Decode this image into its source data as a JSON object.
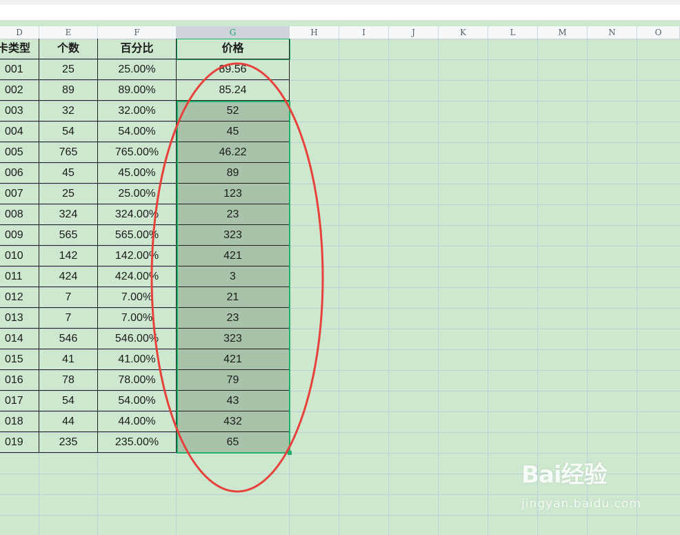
{
  "columns": [
    "D",
    "E",
    "F",
    "G",
    "H",
    "I",
    "J",
    "K",
    "L",
    "M",
    "N",
    "O"
  ],
  "selected_column": "G",
  "table": {
    "headers": [
      "卡类型",
      "个数",
      "百分比",
      "价格"
    ],
    "rows": [
      [
        "001",
        "25",
        "25.00%",
        "89.56"
      ],
      [
        "002",
        "89",
        "89.00%",
        "85.24"
      ],
      [
        "003",
        "32",
        "32.00%",
        "52"
      ],
      [
        "004",
        "54",
        "54.00%",
        "45"
      ],
      [
        "005",
        "765",
        "765.00%",
        "46.22"
      ],
      [
        "006",
        "45",
        "45.00%",
        "89"
      ],
      [
        "007",
        "25",
        "25.00%",
        "123"
      ],
      [
        "008",
        "324",
        "324.00%",
        "23"
      ],
      [
        "009",
        "565",
        "565.00%",
        "323"
      ],
      [
        "010",
        "142",
        "142.00%",
        "421"
      ],
      [
        "011",
        "424",
        "424.00%",
        "3"
      ],
      [
        "012",
        "7",
        "7.00%",
        "21"
      ],
      [
        "013",
        "7",
        "7.00%",
        "23"
      ],
      [
        "014",
        "546",
        "546.00%",
        "323"
      ],
      [
        "015",
        "41",
        "41.00%",
        "421"
      ],
      [
        "016",
        "78",
        "78.00%",
        "79"
      ],
      [
        "017",
        "54",
        "54.00%",
        "43"
      ],
      [
        "018",
        "44",
        "44.00%",
        "432"
      ],
      [
        "019",
        "235",
        "235.00%",
        "65"
      ]
    ]
  },
  "colors": {
    "sheet_background": "#cde8cf",
    "selected_fill": "#a9c3ab",
    "selection_border": "#1fb06a",
    "annotation_ellipse": "#e8403a"
  },
  "watermark": {
    "logo_text": "Bai经验",
    "url": "jingyan.baidu.com"
  }
}
